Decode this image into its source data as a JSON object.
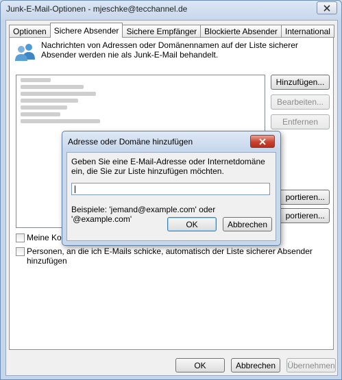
{
  "window": {
    "title": "Junk-E-Mail-Optionen - mjeschke@tecchannel.de"
  },
  "tabs": [
    {
      "label": "Optionen",
      "active": false
    },
    {
      "label": "Sichere Absender",
      "active": true
    },
    {
      "label": "Sichere Empfänger",
      "active": false
    },
    {
      "label": "Blockierte Absender",
      "active": false
    },
    {
      "label": "International",
      "active": false
    }
  ],
  "panel": {
    "description": "Nachrichten von Adressen oder Domänennamen auf der Liste sicherer Absender werden nie als Junk-E-Mail behandelt.",
    "buttons": {
      "add": "Hinzufügen...",
      "edit": "Bearbeiten...",
      "remove": "Entfernen",
      "import_partial": "portieren...",
      "export_partial": "portieren..."
    },
    "checkbox1_partial": "Meine Kon",
    "checkbox2": "Personen, an die ich E-Mails schicke, automatisch der Liste sicherer Absender hinzufügen"
  },
  "dialog": {
    "title": "Adresse oder Domäne hinzufügen",
    "prompt": "Geben Sie eine E-Mail-Adresse oder Internetdomäne ein, die Sie zur Liste hinzufügen möchten.",
    "input_value": "",
    "example": "Beispiele: 'jemand@example.com' oder '@example.com'",
    "ok": "OK",
    "cancel": "Abbrechen"
  },
  "footer": {
    "ok": "OK",
    "cancel": "Abbrechen",
    "apply": "Übernehmen"
  }
}
